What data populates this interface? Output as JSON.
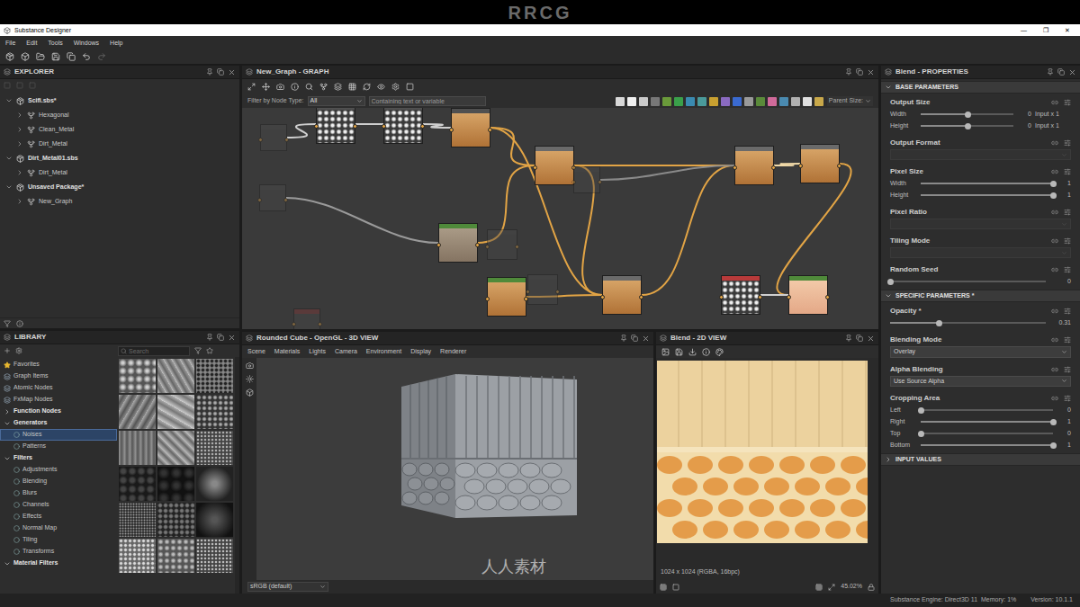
{
  "watermark": {
    "top": "RRCG",
    "bottom": "人人素材"
  },
  "window": {
    "title": "Substance Designer",
    "controls": [
      "—",
      "❐",
      "✕"
    ]
  },
  "menu": [
    "File",
    "Edit",
    "Tools",
    "Windows",
    "Help"
  ],
  "explorer": {
    "title": "EXPLORER",
    "items": [
      {
        "label": "Scifi.sbs*",
        "depth": 0,
        "kind": "package",
        "expanded": true
      },
      {
        "label": "Hexagonal",
        "depth": 1,
        "kind": "graph",
        "expanded": false
      },
      {
        "label": "Clean_Metal",
        "depth": 1,
        "kind": "graph",
        "expanded": false
      },
      {
        "label": "Dirt_Metal",
        "depth": 1,
        "kind": "graph",
        "expanded": false
      },
      {
        "label": "Dirt_Metal01.sbs",
        "depth": 0,
        "kind": "package",
        "expanded": true
      },
      {
        "label": "Dirt_Metal",
        "depth": 1,
        "kind": "graph",
        "expanded": false
      },
      {
        "label": "Unsaved Package*",
        "depth": 0,
        "kind": "package",
        "expanded": true
      },
      {
        "label": "New_Graph",
        "depth": 1,
        "kind": "graph",
        "expanded": false
      }
    ]
  },
  "graph": {
    "title": "New_Graph - GRAPH",
    "filter_label": "Filter by Node Type:",
    "filter_value": "All",
    "search_placeholder": "Containing text or variable",
    "parent_size": "Parent Size:",
    "nodes": [
      {
        "kind": "faded",
        "color": "#505050"
      },
      {
        "kind": "noise",
        "color": "#505050"
      },
      {
        "kind": "noise",
        "color": "#505050"
      },
      {
        "kind": "orange",
        "color": "#505050"
      },
      {
        "kind": "orange",
        "color": "#6a6a6a"
      },
      {
        "kind": "faded",
        "color": "#505050"
      },
      {
        "kind": "orange",
        "color": "#6a6a6a"
      },
      {
        "kind": "orange",
        "color": "#6a6a6a"
      },
      {
        "kind": "faded",
        "color": "#505050"
      },
      {
        "kind": "beige",
        "color": "#4f8a3a"
      },
      {
        "kind": "faded",
        "color": "#505050"
      },
      {
        "kind": "orange",
        "color": "#4f8a3a"
      },
      {
        "kind": "faded",
        "color": "#505050"
      },
      {
        "kind": "orange",
        "color": "#6a6a6a"
      },
      {
        "kind": "noise",
        "color": "#b83a3a"
      },
      {
        "kind": "peach",
        "color": "#4f8a3a"
      },
      {
        "kind": "faded",
        "color": "#8a3a3a"
      }
    ],
    "edges": [
      {
        "from": 3,
        "to": 4,
        "color": "#e2a445"
      },
      {
        "from": 9,
        "to": 4,
        "color": "#e2a445"
      },
      {
        "from": 4,
        "to": 6,
        "color": "#e2a445"
      },
      {
        "from": 4,
        "to": 13,
        "color": "#e2a445"
      },
      {
        "from": 11,
        "to": 13,
        "color": "#e2a445"
      },
      {
        "from": 13,
        "to": 6,
        "color": "#e2a445"
      },
      {
        "from": 3,
        "to": 13,
        "color": "#e2a445"
      },
      {
        "from": 6,
        "to": 7,
        "color": "#f0d9a8"
      },
      {
        "from": 7,
        "to": 15,
        "color": "#e2a445"
      },
      {
        "from": 0,
        "to": 1,
        "color": "#cfcfcf"
      },
      {
        "from": 1,
        "to": 2,
        "color": "#cfcfcf"
      },
      {
        "from": 2,
        "to": 3,
        "color": "#cfcfcf"
      },
      {
        "from": 14,
        "to": 15,
        "color": "#cfcfcf"
      },
      {
        "from": 5,
        "to": 6,
        "color": "#8a8a8a"
      },
      {
        "from": 8,
        "to": 9,
        "color": "#9a9a9a"
      }
    ]
  },
  "library": {
    "title": "LIBRARY",
    "search_placeholder": "Search",
    "items": [
      {
        "label": "Favorites",
        "kind": "favorite",
        "selected": false
      },
      {
        "label": "Graph Items",
        "kind": "item",
        "selected": false
      },
      {
        "label": "Atomic Nodes",
        "kind": "item",
        "selected": false
      },
      {
        "label": "FxMap Nodes",
        "kind": "item",
        "selected": false
      },
      {
        "label": "Function Nodes",
        "kind": "section",
        "expanded": false,
        "selected": false
      },
      {
        "label": "Generators",
        "kind": "section",
        "expanded": true,
        "selected": false
      },
      {
        "label": "Noises",
        "kind": "sub",
        "selected": true
      },
      {
        "label": "Patterns",
        "kind": "sub",
        "selected": false
      },
      {
        "label": "Filters",
        "kind": "section",
        "expanded": true,
        "selected": false
      },
      {
        "label": "Adjustments",
        "kind": "sub",
        "selected": false
      },
      {
        "label": "Blending",
        "kind": "sub",
        "selected": false
      },
      {
        "label": "Blurs",
        "kind": "sub",
        "selected": false
      },
      {
        "label": "Channels",
        "kind": "sub",
        "selected": false
      },
      {
        "label": "Effects",
        "kind": "sub",
        "selected": false
      },
      {
        "label": "Normal Map",
        "kind": "sub",
        "selected": false
      },
      {
        "label": "Tiling",
        "kind": "sub",
        "selected": false
      },
      {
        "label": "Transforms",
        "kind": "sub",
        "selected": false
      },
      {
        "label": "Material Filters",
        "kind": "section",
        "expanded": true,
        "selected": false
      }
    ]
  },
  "view3d": {
    "title": "Rounded Cube - OpenGL - 3D VIEW",
    "menu": [
      "Scene",
      "Materials",
      "Lights",
      "Camera",
      "Environment",
      "Display",
      "Renderer"
    ],
    "colorspace": "sRGB (default)"
  },
  "view2d": {
    "title": "Blend - 2D VIEW",
    "info": "1024 x 1024 (RGBA, 16bpc)",
    "zoom": "45.02%"
  },
  "properties": {
    "title": "Blend - PROPERTIES",
    "sections": [
      {
        "title": "BASE PARAMETERS",
        "expanded": true,
        "params": [
          {
            "label": "Output Size",
            "kind": "sliders",
            "rows": [
              {
                "label": "Width",
                "level": 0.5,
                "value": "0",
                "extra": "Input x 1"
              },
              {
                "label": "Height",
                "level": 0.5,
                "value": "0",
                "extra": "Input x 1"
              }
            ]
          },
          {
            "label": "Output Format",
            "kind": "dropdown",
            "disabled": true
          },
          {
            "label": "Pixel Size",
            "kind": "sliders",
            "rows": [
              {
                "label": "Width",
                "level": 1,
                "value": "1"
              },
              {
                "label": "Height",
                "level": 1,
                "value": "1"
              }
            ]
          },
          {
            "label": "Pixel Ratio",
            "kind": "dropdown",
            "disabled": true
          },
          {
            "label": "Tiling Mode",
            "kind": "dropdown",
            "disabled": true
          },
          {
            "label": "Random Seed",
            "kind": "slider",
            "level": 0,
            "value": "0"
          }
        ]
      },
      {
        "title": "SPECIFIC PARAMETERS *",
        "expanded": true,
        "params": [
          {
            "label": "Opacity *",
            "kind": "slider",
            "level": 0.31,
            "value": "0.31"
          },
          {
            "label": "Blending Mode",
            "kind": "dropdown",
            "disabled": false,
            "value": "Overlay"
          },
          {
            "label": "Alpha Blending",
            "kind": "dropdown",
            "disabled": false,
            "value": "Use Source Alpha"
          },
          {
            "label": "Cropping Area",
            "kind": "sliders",
            "rows": [
              {
                "label": "Left",
                "level": 0,
                "value": "0"
              },
              {
                "label": "Right",
                "level": 1,
                "value": "1"
              },
              {
                "label": "Top",
                "level": 0,
                "value": "0"
              },
              {
                "label": "Bottom",
                "level": 1,
                "value": "1"
              }
            ]
          }
        ]
      },
      {
        "title": "INPUT VALUES",
        "expanded": false,
        "params": []
      }
    ]
  },
  "status": {
    "engine": "Substance Engine: Direct3D 11  Memory: 1%",
    "version": "Version: 10.1.1"
  }
}
